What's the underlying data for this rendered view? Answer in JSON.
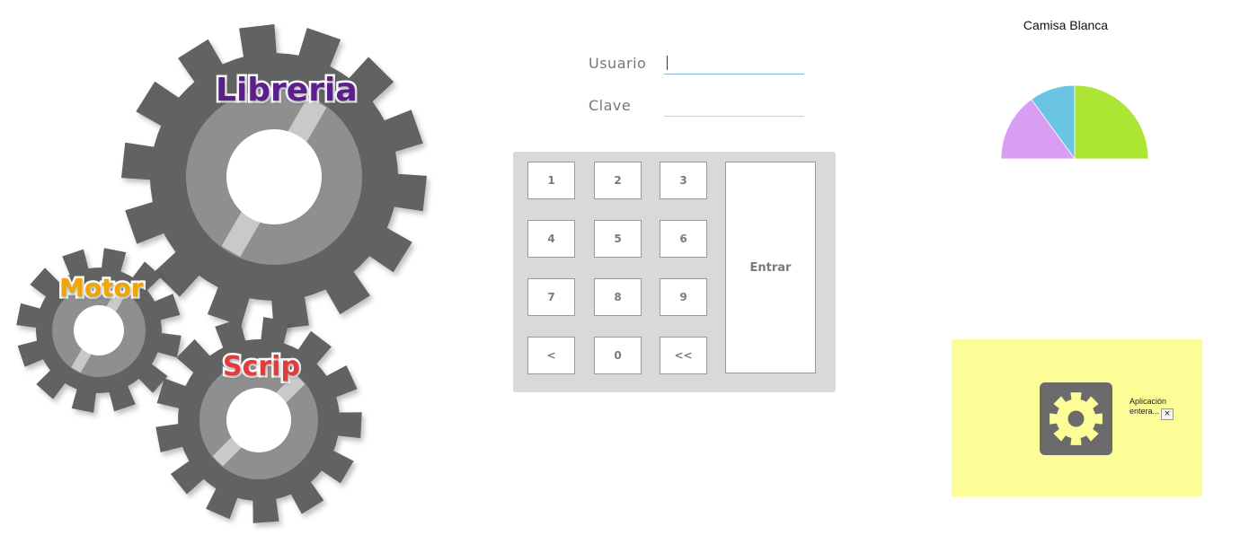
{
  "gears": {
    "libreria_label": "Libreria",
    "motor_label": "Motor",
    "scrip_label": "Scrip",
    "gear_color": "#626262",
    "ring_color": "#8f8f8f",
    "libreria_color": "#5b1f8c",
    "motor_color": "#f0a500",
    "scrip_color": "#e23b3b"
  },
  "login": {
    "usuario_label": "Usuario",
    "usuario_value": "",
    "clave_label": "Clave",
    "clave_value": ""
  },
  "keypad": {
    "keys": [
      "1",
      "2",
      "3",
      "4",
      "5",
      "6",
      "7",
      "8",
      "9",
      "<",
      "0",
      "<<"
    ],
    "enter_label": "Entrar"
  },
  "chart_data": {
    "type": "pie",
    "title": "Camisa Blanca",
    "layout": "half-pie",
    "slices": [
      {
        "value": 50,
        "color": "#ade535"
      },
      {
        "value": 10,
        "color": "#69c5e3"
      },
      {
        "value": 15,
        "color": "#d79ef2"
      }
    ]
  },
  "notification": {
    "text": "Aplicación entera...",
    "close_label": "×",
    "background": "#fdfd97",
    "icon": "gear-icon"
  }
}
